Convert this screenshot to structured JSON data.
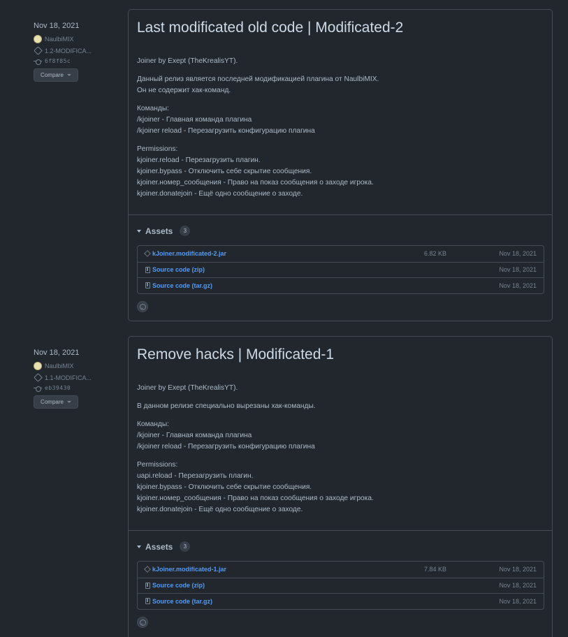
{
  "releases": [
    {
      "date": "Nov 18, 2021",
      "author": "NaulbiMIX",
      "tag": "1.2-MODIFICA...",
      "commit": "6f8f85c",
      "compare_label": "Compare",
      "title": "Last modificated old code | Modificated-2",
      "body": {
        "p1": "Joiner by Exept (TheKrealisYT).",
        "p2_l1": "Данный релиз является последней модификацией плагина от NaulbiMIX.",
        "p2_l2": "Он не содержит хак-команд.",
        "p3_l1": "Команды:",
        "p3_l2": "/kjoiner - Главная команда плагина",
        "p3_l3": "/kjoiner reload - Перезагрузить конфигурацию плагина",
        "p4_l1": "Permissions:",
        "p4_l2": "kjoiner.reload - Перезагрузить плагин.",
        "p4_l3": "kjoiner.bypass - Отключить себе скрытие сообщения.",
        "p4_l4": "kjoiner.номер_сообщения - Право на показ сообщения о заходе игрока.",
        "p4_l5": "kjoiner.donatejoin - Ещё одно сообщение о заходе."
      },
      "assets_label": "Assets",
      "assets_count": "3",
      "assets": [
        {
          "name": "kJoiner.modificated-2.jar",
          "size": "6.82 KB",
          "date": "Nov 18, 2021",
          "icon": "package-icon"
        },
        {
          "name": "Source code (zip)",
          "size": "",
          "date": "Nov 18, 2021",
          "icon": "file-zip-icon"
        },
        {
          "name": "Source code (tar.gz)",
          "size": "",
          "date": "Nov 18, 2021",
          "icon": "file-zip-icon"
        }
      ]
    },
    {
      "date": "Nov 18, 2021",
      "author": "NaulbiMIX",
      "tag": "1.1-MODIFICA...",
      "commit": "eb39430",
      "compare_label": "Compare",
      "title": "Remove hacks | Modificated-1",
      "body": {
        "p1": "Joiner by Exept (TheKrealisYT).",
        "p2_l1": "В данном релизе специально вырезаны хак-команды.",
        "p3_l1": "Команды:",
        "p3_l2": "/kjoiner - Главная команда плагина",
        "p3_l3": "/kjoiner reload - Перезагрузить конфигурацию плагина",
        "p4_l1": "Permissions:",
        "p4_l2": "uapi.reload - Перезагрузить плагин.",
        "p4_l3": "kjoiner.bypass - Отключить себе скрытие сообщения.",
        "p4_l4": "kjoiner.номер_сообщения - Право на показ сообщения о заходе игрока.",
        "p4_l5": "kjoiner.donatejoin - Ещё одно сообщение о заходе."
      },
      "assets_label": "Assets",
      "assets_count": "3",
      "assets": [
        {
          "name": "kJoiner.modificated-1.jar",
          "size": "7.84 KB",
          "date": "Nov 18, 2021",
          "icon": "package-icon"
        },
        {
          "name": "Source code (zip)",
          "size": "",
          "date": "Nov 18, 2021",
          "icon": "file-zip-icon"
        },
        {
          "name": "Source code (tar.gz)",
          "size": "",
          "date": "Nov 18, 2021",
          "icon": "file-zip-icon"
        }
      ]
    }
  ]
}
